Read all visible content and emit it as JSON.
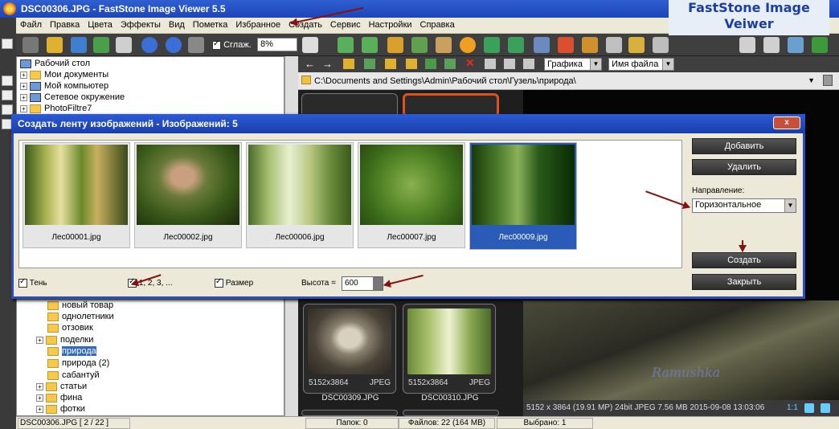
{
  "window": {
    "title": "DSC00306.JPG  -  FastStone Image Viewer 5.5",
    "brand_line1": "FastStone Image",
    "brand_line2": "Veiwer"
  },
  "menu": [
    "Файл",
    "Правка",
    "Цвета",
    "Эффекты",
    "Вид",
    "Пометка",
    "Избранное",
    "Создать",
    "Сервис",
    "Настройки",
    "Справка"
  ],
  "toolbar": {
    "smooth_label": "Сглаж.",
    "zoom_value": "8%"
  },
  "tree": {
    "top_items": [
      {
        "label": "Рабочий стол",
        "icon": "desktop-icon"
      },
      {
        "label": "Мои документы",
        "icon": "folder-icon"
      },
      {
        "label": "Мой компьютер",
        "icon": "computer-icon"
      },
      {
        "label": "Сетевое окружение",
        "icon": "network-icon"
      },
      {
        "label": "PhotoFiltre7",
        "icon": "folder-icon"
      }
    ],
    "bottom_items": [
      {
        "label": "новый товар",
        "expand": false,
        "selected": false
      },
      {
        "label": "однолетники",
        "expand": false,
        "selected": false
      },
      {
        "label": "отзовик",
        "expand": false,
        "selected": false
      },
      {
        "label": "поделки",
        "expand": true,
        "selected": false
      },
      {
        "label": "природа",
        "expand": false,
        "selected": true
      },
      {
        "label": "природа (2)",
        "expand": false,
        "selected": false
      },
      {
        "label": "сабантуй",
        "expand": false,
        "selected": false
      },
      {
        "label": "статьи",
        "expand": true,
        "selected": false
      },
      {
        "label": "фина",
        "expand": true,
        "selected": false
      },
      {
        "label": "фотки",
        "expand": true,
        "selected": false
      }
    ]
  },
  "browser": {
    "filter": "Графика",
    "sort": "Имя файла",
    "path": "C:\\Documents and Settings\\Admin\\Рабочий стол\\Гузель\\природа\\",
    "thumbs": [
      {
        "name": "DSC00309.JPG",
        "size": "5152x3864",
        "type": "JPEG"
      },
      {
        "name": "DSC00310.JPG",
        "size": "5152x3864",
        "type": "JPEG"
      }
    ]
  },
  "preview": {
    "info": "5152 x 3864 (19.91 MP)  24bit  JPEG   7.56 MB   2015-09-08 13:03:06",
    "ratio": "1:1",
    "watermark": "Ramushka"
  },
  "status": {
    "file": "DSC00306.JPG [ 2 / 22 ]",
    "folders": "Папок: 0",
    "files": "Файлов: 22 (164 MB)",
    "selected": "Выбрано: 1"
  },
  "dialog": {
    "title": "Создать ленту изображений  -  Изображений: 5",
    "close": "x",
    "images": [
      "Лес00001.jpg",
      "Лес00002.jpg",
      "Лес00006.jpg",
      "Лес00007.jpg",
      "Лес00009.jpg"
    ],
    "buttons": {
      "add": "Добавить",
      "delete": "Удалить",
      "create": "Создать",
      "close": "Закрыть"
    },
    "direction_label": "Направление:",
    "direction_value": "Горизонтальное",
    "options": {
      "shadow": "Тень",
      "numbering": "1, 2, 3, ...",
      "size": "Размер"
    },
    "height_label": "Высота =",
    "height_value": "600"
  }
}
